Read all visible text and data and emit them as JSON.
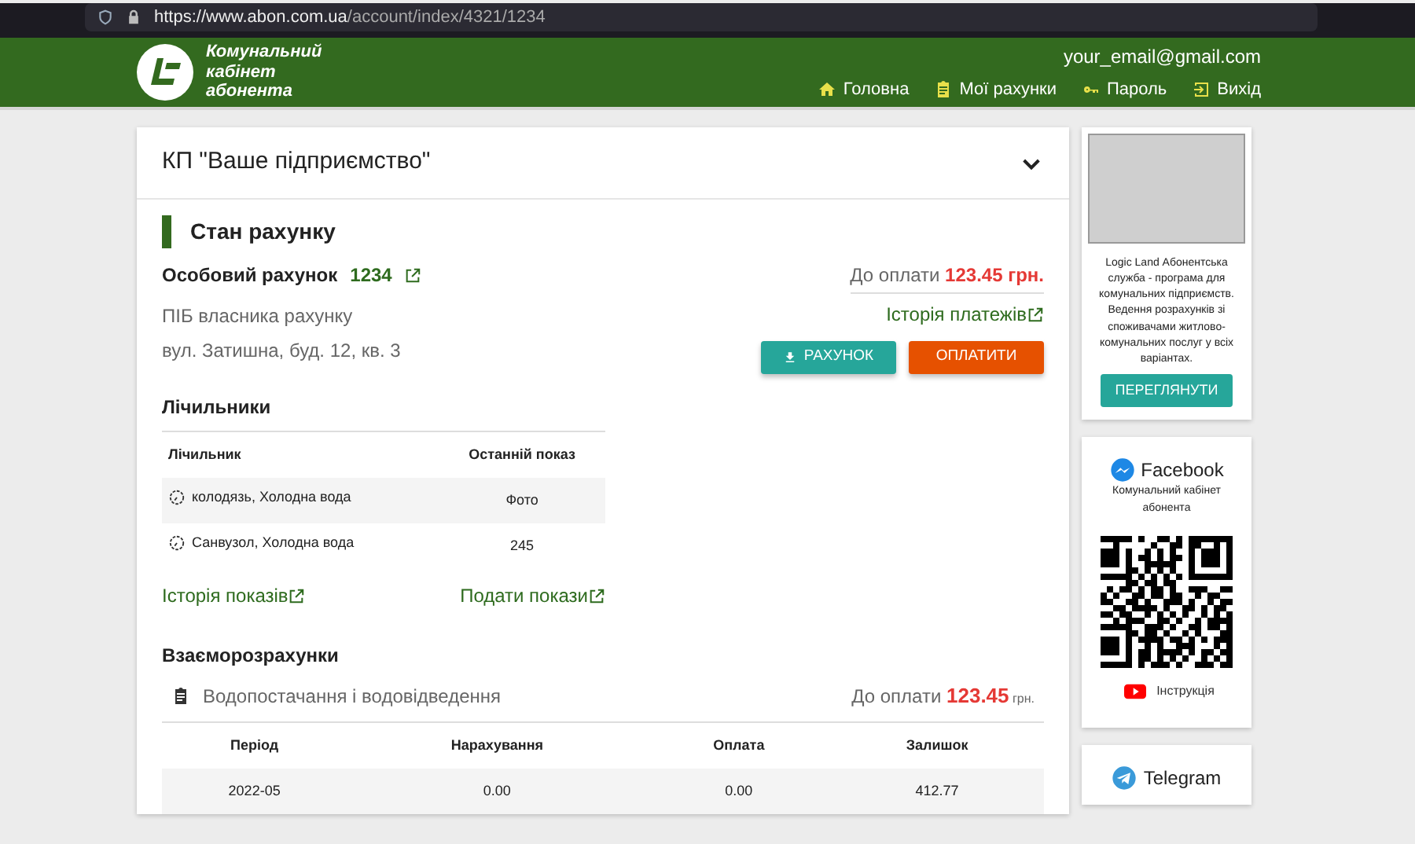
{
  "browser": {
    "url_host": "https://www.abon.com.ua",
    "url_path": "/account/index/4321/1234"
  },
  "header": {
    "brand": "Комунальний кабінет абонента",
    "email": "your_email@gmail.com",
    "nav": [
      {
        "label": "Головна"
      },
      {
        "label": "Мої рахунки"
      },
      {
        "label": "Пароль"
      },
      {
        "label": "Вихід"
      }
    ]
  },
  "company": {
    "title": "КП \"Ваше підприємство\"",
    "expanded": false
  },
  "account": {
    "section_title": "Стан рахунку",
    "label": "Особовий рахунок",
    "number": "1234",
    "owner": "ПІБ власника рахунку",
    "address": "вул. Затишна, буд. 12, кв. 3",
    "due_label": "До оплати",
    "due_amount": "123.45 грн.",
    "history_link": "Історія платежів",
    "buttons": [
      {
        "label": "РАХУНОК",
        "kind": "download"
      },
      {
        "label": "ОПЛАТИТИ",
        "kind": "pay"
      }
    ]
  },
  "meters": {
    "title": "Лічильники",
    "columns": [
      "Лічильник",
      "Останній показ"
    ],
    "rows": [
      {
        "name": "колодязь, Холодна вода",
        "reading": "Фото"
      },
      {
        "name": "Санвузол, Холодна вода",
        "reading": "245"
      }
    ],
    "links": [
      "Історія показів",
      "Подати покази"
    ]
  },
  "settlements": {
    "title": "Взаєморозрахунки",
    "service": "Водопостачання і водовідведення",
    "due_label": "До оплати",
    "due_amount": "123.45",
    "currency": "грн.",
    "columns": [
      "Період",
      "Нарахування",
      "Оплата",
      "Залишок"
    ],
    "rows": [
      [
        "2022-05",
        "0.00",
        "0.00",
        "412.77"
      ]
    ]
  },
  "promo": {
    "text": "Logic Land Абонентська служба - програма для комунальних підприємств. Ведення розрахунків зі споживачами житлово-комунальних послуг у всіх варіантах.",
    "button": "ПЕРЕГЛЯНУТИ"
  },
  "facebook": {
    "title": "Facebook",
    "subtitle": "Комунальний кабінет абонента",
    "video_link": "Інструкція"
  },
  "telegram": {
    "title": "Telegram"
  }
}
